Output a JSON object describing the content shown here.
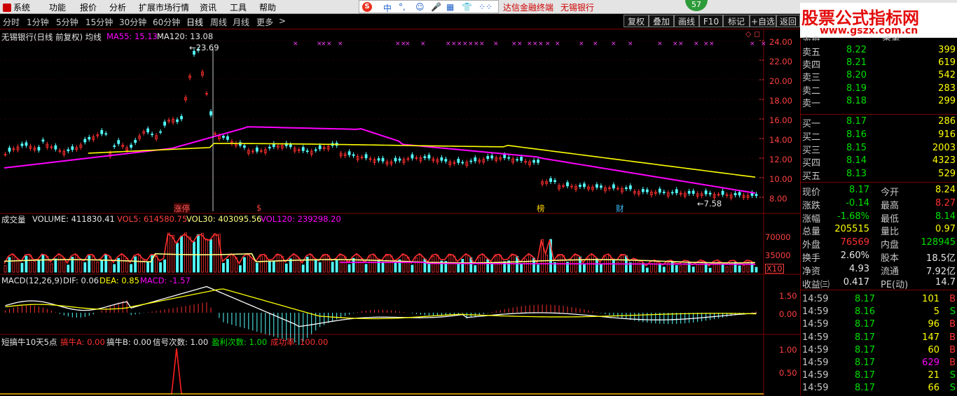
{
  "menu": [
    "系统",
    "功能",
    "报价",
    "分析",
    "扩展市场行情",
    "资讯",
    "工具",
    "帮助"
  ],
  "ime": {
    "label": "中",
    "glyphs": [
      "°,",
      "☺",
      "🎤",
      "▦",
      "👕",
      "⁘⁘"
    ]
  },
  "taskbar_text": [
    "达信金融终端",
    "无锡银行"
  ],
  "circle_value": "57",
  "toolbar": {
    "periods": [
      "分时",
      "1分钟",
      "5分钟",
      "15分钟",
      "30分钟",
      "60分钟",
      "日线",
      "周线",
      "月线",
      "更多"
    ],
    "selected": "日线",
    "more_arrow": ">",
    "buttons": [
      "复权",
      "叠加",
      "画线",
      "F10",
      "标记",
      "+自选",
      "返回"
    ]
  },
  "logo": {
    "title": "股票公式指标网",
    "url": "www.gszx.com.cn"
  },
  "main_header": {
    "name": "无锡银行(日线 前复权)",
    "ma_label": "均线",
    "ma55": "MA55: 15.13",
    "ma120": "MA120: 13.08"
  },
  "price_chart": {
    "high_label": "23.69",
    "low_label": "7.58",
    "marks": [
      "涨停",
      "$",
      "榜",
      "财"
    ],
    "y_ticks": [
      "24.00",
      "22.00",
      "20.00",
      "18.00",
      "16.00",
      "14.00",
      "12.00",
      "10.00",
      "8.00"
    ]
  },
  "volume_header": {
    "name": "成交量",
    "volume": "VOLUME: 411830.41",
    "vol5": "VOL5: 614580.75",
    "vol30": "VOL30: 403095.56",
    "vol120": "VOL120: 239298.20"
  },
  "volume_ticks": [
    "70000",
    "35000"
  ],
  "volume_unit": "X10",
  "macd_header": {
    "name": "MACD(12,26,9)",
    "dif": "DIF: 0.06",
    "dea": "DEA: 0.85",
    "macd": "MACD: -1.57"
  },
  "macd_ticks": [
    "1.50",
    "0.00"
  ],
  "signal_header": {
    "name": "短搞牛10天5点",
    "a": "搞牛A: 0.00",
    "b": "搞牛B: 0.00",
    "count": "信号次数: 1.00",
    "profit": "盈利次数: 1.00",
    "rate": "成功率: 100.00"
  },
  "signal_ticks": [
    "1.00",
    "0.50"
  ],
  "quote": {
    "top_clip": [
      "卖盘",
      "委差"
    ],
    "asks": [
      {
        "label": "卖五",
        "price": "8.22",
        "vol": "399"
      },
      {
        "label": "卖四",
        "price": "8.21",
        "vol": "619"
      },
      {
        "label": "卖三",
        "price": "8.20",
        "vol": "542"
      },
      {
        "label": "卖二",
        "price": "8.19",
        "vol": "283"
      },
      {
        "label": "卖一",
        "price": "8.18",
        "vol": "299"
      }
    ],
    "bids": [
      {
        "label": "买一",
        "price": "8.17",
        "vol": "286"
      },
      {
        "label": "买二",
        "price": "8.16",
        "vol": "916"
      },
      {
        "label": "买三",
        "price": "8.15",
        "vol": "2003"
      },
      {
        "label": "买四",
        "price": "8.14",
        "vol": "4323"
      },
      {
        "label": "买五",
        "price": "8.13",
        "vol": "529"
      }
    ],
    "stats": [
      {
        "l1": "现价",
        "v1": "8.17",
        "l2": "今开",
        "v2": "8.24"
      },
      {
        "l1": "涨跌",
        "v1": "-0.14",
        "l2": "最高",
        "v2": "8.27"
      },
      {
        "l1": "涨幅",
        "v1": "-1.68%",
        "l2": "最低",
        "v2": "8.14"
      },
      {
        "l1": "总量",
        "v1": "205515",
        "l2": "量比",
        "v2": "0.97"
      },
      {
        "l1": "外盘",
        "v1": "76569",
        "l2": "内盘",
        "v2": "128945"
      },
      {
        "l1": "换手",
        "v1": "2.60%",
        "l2": "股本",
        "v2": "18.5亿"
      },
      {
        "l1": "净资",
        "v1": "4.93",
        "l2": "流通",
        "v2": "7.92亿"
      },
      {
        "l1": "收益㈢",
        "v1": "0.417",
        "l2": "PE(动)",
        "v2": "14.7"
      }
    ],
    "ticks": [
      {
        "time": "14:59",
        "price": "8.17",
        "vol": "101",
        "side": "B"
      },
      {
        "time": "14:59",
        "price": "8.16",
        "vol": "5",
        "side": "S"
      },
      {
        "time": "14:59",
        "price": "8.17",
        "vol": "96",
        "side": "B"
      },
      {
        "time": "14:59",
        "price": "8.17",
        "vol": "147",
        "side": "B"
      },
      {
        "time": "14:59",
        "price": "8.17",
        "vol": "60",
        "side": "B"
      },
      {
        "time": "14:59",
        "price": "8.17",
        "vol": "629",
        "side": "B"
      },
      {
        "time": "14:59",
        "price": "8.17",
        "vol": "21",
        "side": "S"
      },
      {
        "time": "14:59",
        "price": "8.17",
        "vol": "66",
        "side": "S"
      }
    ]
  },
  "colors": {
    "up": "#ff3030",
    "down": "#54ffff",
    "ma55": "#ff00ff",
    "ma120": "#ffff00",
    "grid": "#7a0000"
  }
}
